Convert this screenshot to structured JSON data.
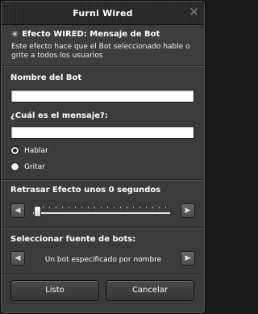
{
  "window": {
    "title": "Furni Wired",
    "close_glyph": "⨯"
  },
  "header": {
    "icon": "star-icon",
    "title": "Efecto WIRED: Mensaje de Bot",
    "description": "Este efecto hace que el Bot seleccionado hable o grite a todos los usuarios"
  },
  "bot_name": {
    "label": "Nombre del Bot",
    "value": ""
  },
  "message": {
    "label": "¿Cuál es el mensaje?:",
    "value": ""
  },
  "mode": {
    "options": [
      {
        "label": "Hablar",
        "selected": true
      },
      {
        "label": "Gritar",
        "selected": false
      }
    ]
  },
  "delay": {
    "label": "Retrasar Efecto unos 0 segundos",
    "value": 0
  },
  "bot_source": {
    "label": "Seleccionar fuente de bots:",
    "value": "Un bot especificado por nombre"
  },
  "actions": {
    "ok": "Listo",
    "cancel": "Cancelar"
  }
}
